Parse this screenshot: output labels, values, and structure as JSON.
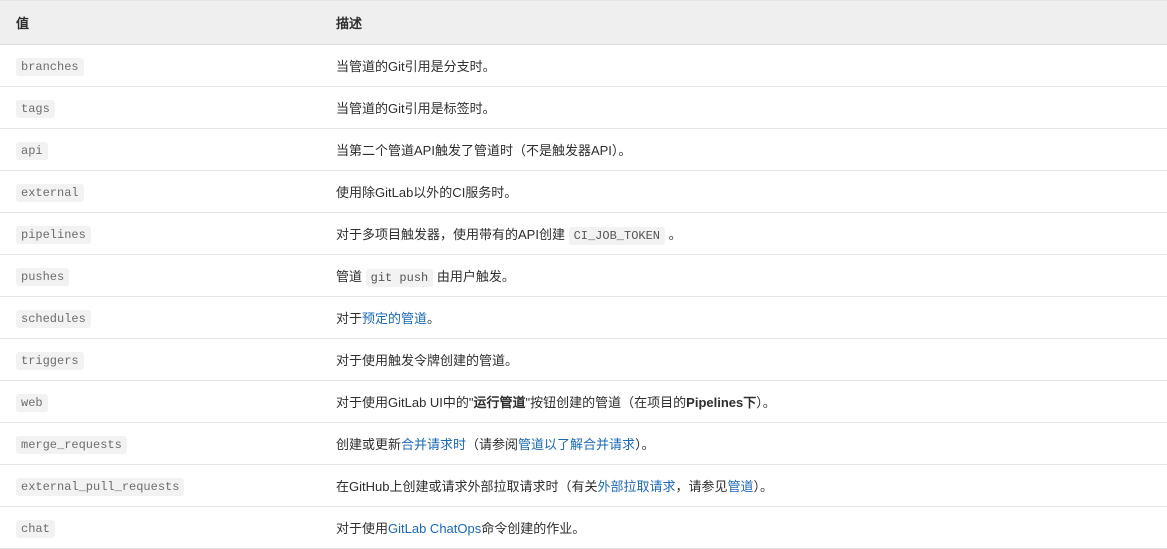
{
  "table": {
    "headers": {
      "value": "值",
      "description": "描述"
    },
    "rows": [
      {
        "value": "branches",
        "desc": [
          {
            "t": "text",
            "v": "当管道的Git引用是分支时。"
          }
        ]
      },
      {
        "value": "tags",
        "desc": [
          {
            "t": "text",
            "v": "当管道的Git引用是标签时。"
          }
        ]
      },
      {
        "value": "api",
        "desc": [
          {
            "t": "text",
            "v": "当第二个管道API触发了管道时（不是触发器API）。"
          }
        ]
      },
      {
        "value": "external",
        "desc": [
          {
            "t": "text",
            "v": "使用除GitLab以外的CI服务时。"
          }
        ]
      },
      {
        "value": "pipelines",
        "desc": [
          {
            "t": "text",
            "v": "对于多项目触发器，使用带有的API创建 "
          },
          {
            "t": "code",
            "v": "CI_JOB_TOKEN"
          },
          {
            "t": "text",
            "v": " 。"
          }
        ]
      },
      {
        "value": "pushes",
        "desc": [
          {
            "t": "text",
            "v": "管道 "
          },
          {
            "t": "code",
            "v": "git push"
          },
          {
            "t": "text",
            "v": " 由用户触发。"
          }
        ]
      },
      {
        "value": "schedules",
        "desc": [
          {
            "t": "text",
            "v": "对于"
          },
          {
            "t": "link",
            "v": "预定的管道"
          },
          {
            "t": "text",
            "v": "。"
          }
        ]
      },
      {
        "value": "triggers",
        "desc": [
          {
            "t": "text",
            "v": "对于使用触发令牌创建的管道。"
          }
        ]
      },
      {
        "value": "web",
        "desc": [
          {
            "t": "text",
            "v": "对于使用GitLab UI中的\""
          },
          {
            "t": "bold",
            "v": "运行管道"
          },
          {
            "t": "text",
            "v": "\"按钮创建的管道（在项目的"
          },
          {
            "t": "bold",
            "v": "Pipelines下"
          },
          {
            "t": "text",
            "v": "）。"
          }
        ]
      },
      {
        "value": "merge_requests",
        "desc": [
          {
            "t": "text",
            "v": "创建或更新"
          },
          {
            "t": "link",
            "v": "合并请求时"
          },
          {
            "t": "text",
            "v": "（请参阅"
          },
          {
            "t": "link",
            "v": "管道以了解合并请求"
          },
          {
            "t": "text",
            "v": "）。"
          }
        ]
      },
      {
        "value": "external_pull_requests",
        "desc": [
          {
            "t": "text",
            "v": "在GitHub上创建或请求外部拉取请求时（有关"
          },
          {
            "t": "link",
            "v": "外部拉取请求"
          },
          {
            "t": "text",
            "v": "，请参见"
          },
          {
            "t": "link",
            "v": "管道"
          },
          {
            "t": "text",
            "v": "）。"
          }
        ]
      },
      {
        "value": "chat",
        "desc": [
          {
            "t": "text",
            "v": "对于使用"
          },
          {
            "t": "link",
            "v": "GitLab ChatOps"
          },
          {
            "t": "text",
            "v": "命令创建的作业。"
          }
        ]
      }
    ]
  }
}
